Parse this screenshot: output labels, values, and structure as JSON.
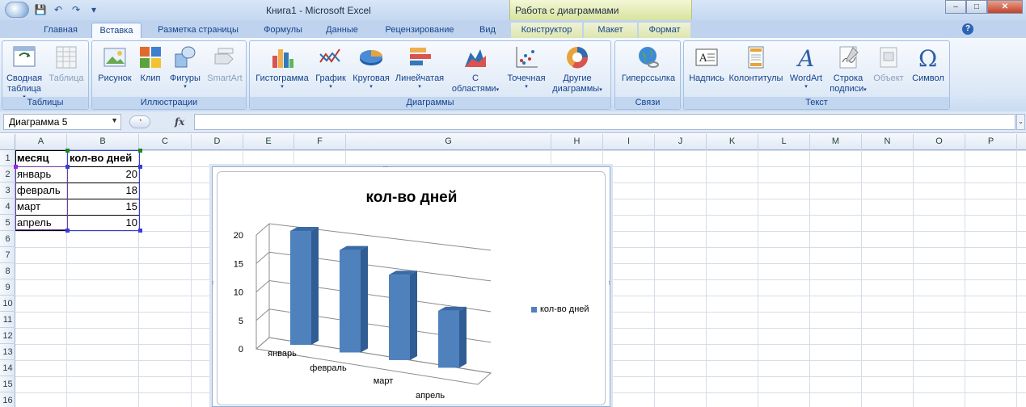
{
  "window": {
    "title": "Книга1 - Microsoft Excel",
    "context_title": "Работа с диаграммами",
    "buttons": {
      "minimize": "–",
      "maximize": "□",
      "close": "✕"
    }
  },
  "qat": {
    "save": "💾",
    "undo": "↶",
    "redo": "↷",
    "customize": "▾"
  },
  "tabs": [
    {
      "label": "Главная"
    },
    {
      "label": "Вставка"
    },
    {
      "label": "Разметка страницы"
    },
    {
      "label": "Формулы"
    },
    {
      "label": "Данные"
    },
    {
      "label": "Рецензирование"
    },
    {
      "label": "Вид"
    },
    {
      "label": "Конструктор"
    },
    {
      "label": "Макет"
    },
    {
      "label": "Формат"
    }
  ],
  "active_tab": "Вставка",
  "ribbon": {
    "groups": {
      "tables": "Таблицы",
      "illustrations": "Иллюстрации",
      "charts": "Диаграммы",
      "links": "Связи",
      "text": "Текст"
    },
    "buttons": {
      "pivot_line1": "Сводная",
      "pivot_line2": "таблица",
      "table": "Таблица",
      "picture": "Рисунок",
      "clip": "Клип",
      "shapes": "Фигуры",
      "smartart": "SmartArt",
      "histogram": "Гистограмма",
      "line": "График",
      "pie": "Круговая",
      "bar": "Линейчатая",
      "area_line1": "С",
      "area_line2": "областями",
      "scatter": "Точечная",
      "other_line1": "Другие",
      "other_line2": "диаграммы",
      "hyperlink": "Гиперссылка",
      "textbox": "Надпись",
      "header_footer": "Колонтитулы",
      "wordart": "WordArt",
      "signature_line1": "Строка",
      "signature_line2": "подписи",
      "object": "Объект",
      "symbol": "Символ"
    }
  },
  "formula_bar": {
    "name_box": "Диаграмма 5",
    "fx": "fx",
    "value": ""
  },
  "columns": [
    "A",
    "B",
    "C",
    "D",
    "E",
    "F",
    "G",
    "H",
    "I",
    "J",
    "K",
    "L",
    "M",
    "N",
    "O",
    "P"
  ],
  "rows": [
    "1",
    "2",
    "3",
    "4",
    "5",
    "6",
    "7",
    "8",
    "9",
    "10",
    "11",
    "12",
    "13",
    "14",
    "15",
    "16"
  ],
  "sheet": {
    "header": [
      "месяц",
      "кол-во дней"
    ],
    "data": [
      [
        "январь",
        "20"
      ],
      [
        "февраль",
        "18"
      ],
      [
        "март",
        "15"
      ],
      [
        "апрель",
        "10"
      ]
    ]
  },
  "colors": {
    "series": "#4f81bd",
    "series_dark": "#2f5d94",
    "series_side": "#3a6aa6",
    "accent": "#15428b",
    "context_tab": "#dde6b0"
  },
  "chart_data": {
    "type": "bar",
    "subtype": "3d-column",
    "title": "кол-во дней",
    "categories": [
      "январь",
      "февраль",
      "март",
      "апрель"
    ],
    "series": [
      {
        "name": "кол-во дней",
        "values": [
          20,
          18,
          15,
          10
        ]
      }
    ],
    "ylim": [
      0,
      20
    ],
    "yticks": [
      "0",
      "5",
      "10",
      "15",
      "20"
    ],
    "grid": true,
    "legend": "right"
  }
}
